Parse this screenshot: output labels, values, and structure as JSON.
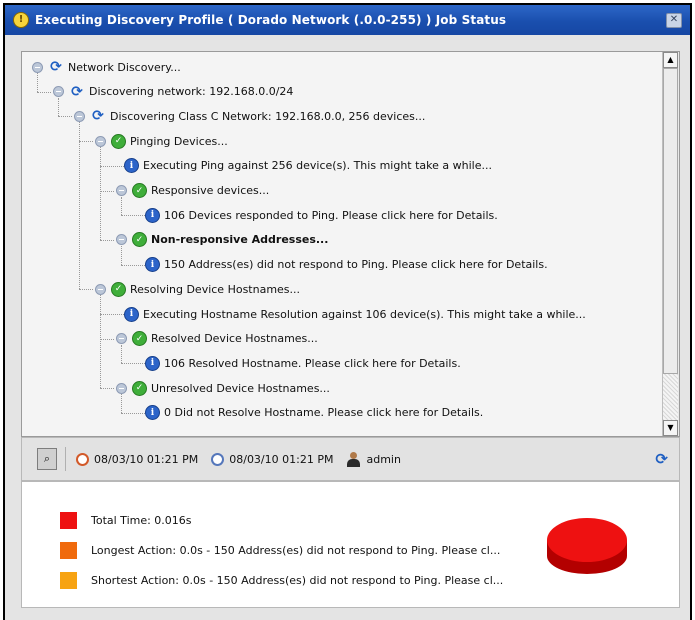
{
  "window": {
    "title": "Executing Discovery Profile ( Dorado Network (.0.0-255) ) Job Status",
    "close_glyph": "✕"
  },
  "tree": [
    {
      "level": 0,
      "icon": "refresh",
      "text": "Network Discovery...",
      "bold": false
    },
    {
      "level": 1,
      "icon": "refresh",
      "text": "Discovering network: 192.168.0.0/24",
      "bold": false
    },
    {
      "level": 2,
      "icon": "refresh",
      "text": "Discovering Class C Network: 192.168.0.0, 256 devices...",
      "bold": false
    },
    {
      "level": 3,
      "icon": "check",
      "text": "Pinging Devices...",
      "bold": false
    },
    {
      "level": 4,
      "icon": "info",
      "text": "Executing Ping against 256 device(s). This might take a while...",
      "bold": false
    },
    {
      "level": 4,
      "icon": "check",
      "text": "Responsive devices...",
      "bold": false
    },
    {
      "level": 5,
      "icon": "info",
      "text": "106 Devices responded to Ping. Please click here for Details.",
      "bold": false
    },
    {
      "level": 4,
      "icon": "check",
      "text": "Non-responsive Addresses...",
      "bold": true
    },
    {
      "level": 5,
      "icon": "info",
      "text": "150 Address(es) did not respond to Ping. Please click here for Details.",
      "bold": false
    },
    {
      "level": 3,
      "icon": "check",
      "text": "Resolving Device Hostnames...",
      "bold": false
    },
    {
      "level": 4,
      "icon": "info",
      "text": "Executing Hostname Resolution against 106 device(s). This might take a while...",
      "bold": false
    },
    {
      "level": 4,
      "icon": "check",
      "text": "Resolved Device Hostnames...",
      "bold": false
    },
    {
      "level": 5,
      "icon": "info",
      "text": "106 Resolved Hostname. Please click here for Details.",
      "bold": false
    },
    {
      "level": 4,
      "icon": "check",
      "text": "Unresolved Device Hostnames...",
      "bold": false
    },
    {
      "level": 5,
      "icon": "info",
      "text": "0 Did not Resolve Hostname. Please click here for Details.",
      "bold": false
    }
  ],
  "toolbar": {
    "start_time": "08/03/10 01:21 PM",
    "end_time": "08/03/10 01:21 PM",
    "user": "admin"
  },
  "summary": {
    "items": [
      {
        "text": "Total Time: 0.016s",
        "color": "#ee1111"
      },
      {
        "text": "Longest Action: 0.0s - 150 Address(es) did not respond to Ping. Please cl...",
        "color": "#f06a0c"
      },
      {
        "text": "Shortest Action: 0.0s - 150 Address(es) did not respond to Ping. Please cl...",
        "color": "#f7a312"
      }
    ],
    "pie_color": "#ee1111"
  }
}
